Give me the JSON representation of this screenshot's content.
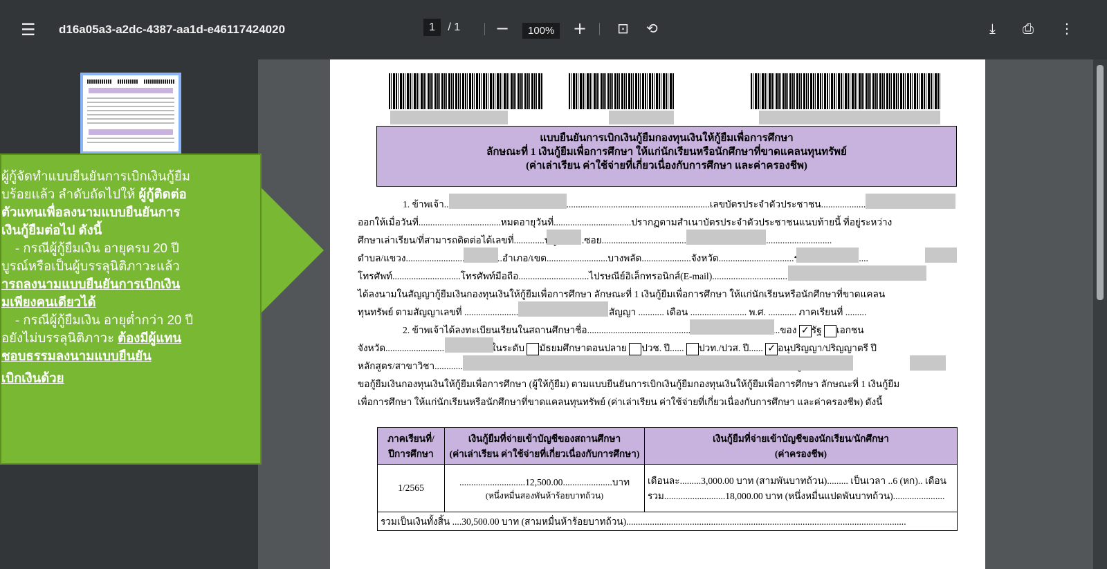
{
  "toolbar": {
    "title": "d16a05a3-a2dc-4387-aa1d-e46117424020",
    "page_current": "1",
    "page_total": "/ 1",
    "zoom": "100%",
    "menu_icon": "menu-icon",
    "zoom_out_icon": "minus-icon",
    "zoom_in_icon": "plus-icon",
    "fit_icon": "fit-page-icon",
    "rotate_icon": "rotate-icon",
    "download_icon": "download-icon",
    "print_icon": "print-icon",
    "more_icon": "more-vert-icon"
  },
  "callout": {
    "lines": [
      {
        "text": "ผู้กู้จัดทำแบบยืนยันการเบิกเงินกู้ยืม",
        "style": ""
      },
      {
        "text": "บร้อยแล้ว ลำดับถัดไปให้ ผู้กู้ติดต่อ",
        "style": ""
      },
      {
        "text": "ตัวแทนเพื่อลงนามแบบยืนยันการ",
        "style": "b"
      },
      {
        "text": "เงินกู้ยืมต่อไป ดังนี้",
        "style": "b"
      },
      {
        "text": "- กรณีผู้กู้ยืมเงิน อายุครบ 20 ปี",
        "style": ""
      },
      {
        "text": "บูรณ์หรือเป็นผู้บรรลุนิติภาวะแล้ว",
        "style": ""
      },
      {
        "text": "ารถลงนามแบบยืนยันการเบิกเงิน",
        "style": "u"
      },
      {
        "text": "มเพียงคนเดียวได้",
        "style": "u"
      },
      {
        "text": "- กรณีผู้กู้ยืมเงิน อายุต่ำกว่า 20 ปี",
        "style": ""
      },
      {
        "text": "อยังไม่บรรลุนิติภาวะ ต้องมีผู้แทน",
        "style": ""
      },
      {
        "text": "ชอบธรรมลงนามแบบยืนยัน",
        "style": "u"
      },
      {
        "text": "เบิกเงินด้วย",
        "style": "u"
      }
    ]
  },
  "document": {
    "title_line1": "แบบยืนยันการเบิกเงินกู้ยืมกองทุนเงินให้กู้ยืมเพื่อการศึกษา",
    "title_line2": "ลักษณะที่ 1 เงินกู้ยืมเพื่อการศึกษา ให้แก่นักเรียนหรือนักศึกษาที่ขาดแคลนทุนทรัพย์",
    "title_line3": "(ค่าเล่าเรียน ค่าใช้จ่ายที่เกี่ยวเนื่องกับการศึกษา และค่าครองชีพ)",
    "lines": [
      "1. ข้าพเจ้า.................................................................................................................เลขบัตรประจำตัวประชาชน.........................",
      "ออกให้เมื่อวันที่...................................หมดอายุวันที่.................................ปรากฏตามสำเนาบัตรประจำตัวประชาชนแนบท้ายนี้ ที่อยู่ระหว่าง",
      "ศึกษาเล่าเรียน/ที่สามารถติดต่อได้เลขที่.............หมู่ที่.........ซอย......................................................ถนน....................................",
      "ตำบล/แขวง.........................................อำเภอ/เขต..........................บางพลัด.....................จังหวัด................................รหัสไปรษณีย์.........",
      "โทรศัพท์.............................โทรศัพท์มือถือ..............................ไปรษณีย์อิเล็กทรอนิกส์(E-mail)..........................................................",
      "ได้ลงนามในสัญญากู้ยืมเงินกองทุนเงินให้กู้ยืมเพื่อการศึกษา ลักษณะที่ 1 เงินกู้ยืมเพื่อการศึกษา ให้แก่นักเรียนหรือนักศึกษาที่ขาดแคลน",
      "ทุนทรัพย์ ตามสัญญาเลขที่ ................................................ วันที่ทำสัญญา ........... เดือน ........................ พ.ศ. ............ ภาคเรียนที่ .........",
      "2. ข้าพเจ้าได้ลงทะเบียนเรียนในสถานศึกษาชื่อ..................................................................................ของ",
      "จังหวัด.............................................ในระดับ",
      "หลักสูตร/สาขาวิชา..................................................................................................................................................หลักสูตร..............ปี",
      "ขอกู้ยืมเงินกองทุนเงินให้กู้ยืมเพื่อการศึกษา (ผู้ให้กู้ยืม) ตามแบบยืนยันการเบิกเงินกู้ยืมกองทุนเงินให้กู้ยืมเพื่อการศึกษา ลักษณะที่ 1 เงินกู้ยืม",
      "เพื่อการศึกษา ให้แก่นักเรียนหรือนักศึกษาที่ขาดแคลนทุนทรัพย์ (ค่าเล่าเรียน ค่าใช้จ่ายที่เกี่ยวเนื่องกับการศึกษา และค่าครองชีพ) ดังนี้"
    ],
    "school_type_1": "รัฐ",
    "school_type_2": "เอกชน",
    "level_1": "มัธยมศึกษาตอนปลาย",
    "level_2": "ปวช. ปี......",
    "level_3": "ปวท./ปวส. ปี......",
    "level_4": "อนุปริญญา/ปริญญาตรี ปี",
    "table": {
      "h1": "ภาคเรียนที่/\nปีการศึกษา",
      "h2": "เงินกู้ยืมที่จ่ายเข้าบัญชีของสถานศึกษา\n(ค่าเล่าเรียน ค่าใช้จ่ายที่เกี่ยวเนื่องกับการศึกษา)",
      "h3": "เงินกู้ยืมที่จ่ายเข้าบัญชีของนักเรียน/นักศึกษา\n(ค่าครองชีพ)",
      "term": "1/2565",
      "school_amount": "............................12,500.00.....................บาท",
      "school_amount_text": "(หนึ่งหมื่นสองพันห้าร้อยบาทถ้วน)",
      "student_line1": "เดือนละ.........3,000.00 บาท (สามพันบาทถ้วน)......... เป็นเวลา ..6 (หก).. เดือน",
      "student_line2": "รวม..........................18,000.00 บาท (หนึ่งหมื่นแปดพันบาทถ้วน)......................",
      "total": "รวมเป็นเงินทั้งสิ้น ....30,500.00 บาท (สามหมื่นห้าร้อยบาทถ้วน)......................................................................................................................."
    }
  }
}
